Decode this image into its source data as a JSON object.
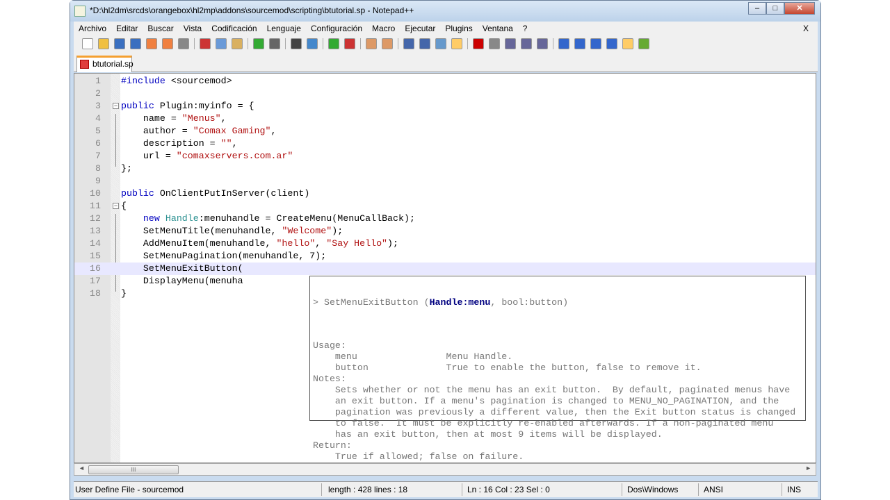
{
  "window": {
    "title": "*D:\\hl2dm\\srcds\\orangebox\\hl2mp\\addons\\sourcemod\\scripting\\btutorial.sp - Notepad++",
    "minimize": "–",
    "maximize": "□",
    "close": "✕"
  },
  "menu": {
    "items": [
      "Archivo",
      "Editar",
      "Buscar",
      "Vista",
      "Codificación",
      "Lenguaje",
      "Configuración",
      "Macro",
      "Ejecutar",
      "Plugins",
      "Ventana",
      "?"
    ],
    "close": "X"
  },
  "toolbar": {
    "icons": [
      "new-file",
      "open-file",
      "save",
      "save-all",
      "close",
      "close-all",
      "print",
      "cut",
      "copy",
      "paste",
      "undo",
      "redo",
      "find",
      "replace",
      "zoom-in",
      "zoom-out",
      "sync-vertical",
      "sync-horizontal",
      "word-wrap",
      "show-all-chars",
      "indent-guide",
      "user-lang",
      "record-macro",
      "stop-record",
      "play-macro",
      "run-macro-multiple",
      "save-macro",
      "fold-all",
      "up",
      "down",
      "unfold",
      "document-map",
      "spell-check"
    ]
  },
  "tab": {
    "label": "btutorial.sp"
  },
  "editor": {
    "current_line": 16,
    "lines": [
      [
        {
          "t": "#include",
          "c": "k"
        },
        {
          "t": " <sourcemod>",
          "c": "d"
        }
      ],
      [],
      [
        {
          "t": "public",
          "c": "k"
        },
        {
          "t": " Plugin:myinfo = {",
          "c": "d"
        }
      ],
      [
        {
          "t": "    name = ",
          "c": "d"
        },
        {
          "t": "\"Menus\"",
          "c": "s"
        },
        {
          "t": ",",
          "c": "d"
        }
      ],
      [
        {
          "t": "    author = ",
          "c": "d"
        },
        {
          "t": "\"Comax Gaming\"",
          "c": "s"
        },
        {
          "t": ",",
          "c": "d"
        }
      ],
      [
        {
          "t": "    description = ",
          "c": "d"
        },
        {
          "t": "\"\"",
          "c": "s"
        },
        {
          "t": ",",
          "c": "d"
        }
      ],
      [
        {
          "t": "    url = ",
          "c": "d"
        },
        {
          "t": "\"comaxservers.com.ar\"",
          "c": "s"
        }
      ],
      [
        {
          "t": "};",
          "c": "d"
        }
      ],
      [],
      [
        {
          "t": "public",
          "c": "k"
        },
        {
          "t": " OnClientPutInServer(client)",
          "c": "d"
        }
      ],
      [
        {
          "t": "{",
          "c": "d"
        }
      ],
      [
        {
          "t": "    ",
          "c": "d"
        },
        {
          "t": "new",
          "c": "k"
        },
        {
          "t": " ",
          "c": "d"
        },
        {
          "t": "Handle",
          "c": "t"
        },
        {
          "t": ":menuhandle = CreateMenu(MenuCallBack);",
          "c": "d"
        }
      ],
      [
        {
          "t": "    SetMenuTitle(menuhandle, ",
          "c": "d"
        },
        {
          "t": "\"Welcome\"",
          "c": "s"
        },
        {
          "t": ");",
          "c": "d"
        }
      ],
      [
        {
          "t": "    AddMenuItem(menuhandle, ",
          "c": "d"
        },
        {
          "t": "\"hello\"",
          "c": "s"
        },
        {
          "t": ", ",
          "c": "d"
        },
        {
          "t": "\"Say Hello\"",
          "c": "s"
        },
        {
          "t": ");",
          "c": "d"
        }
      ],
      [
        {
          "t": "    SetMenuPagination(menuhandle, 7);",
          "c": "d"
        }
      ],
      [
        {
          "t": "    SetMenuExitButton(",
          "c": "d"
        }
      ],
      [
        {
          "t": "    DisplayMenu(menuha",
          "c": "d"
        }
      ],
      [
        {
          "t": "}",
          "c": "d"
        }
      ]
    ]
  },
  "calltip": {
    "sig_pre": "> SetMenuExitButton (",
    "sig_hl": "Handle:menu",
    "sig_post": ", bool:button)",
    "lines": [
      "",
      "Usage:",
      "    menu                Menu Handle.",
      "    button              True to enable the button, false to remove it.",
      "Notes:",
      "    Sets whether or not the menu has an exit button.  By default, paginated menus have",
      "    an exit button. If a menu's pagination is changed to MENU_NO_PAGINATION, and the",
      "    pagination was previously a different value, then the Exit button status is changed",
      "    to false.  It must be explicitly re-enabled afterwards. If a non-paginated menu",
      "    has an exit button, then at most 9 items will be displayed.",
      "Return:",
      "    True if allowed; false on failure."
    ]
  },
  "scrollbar": {
    "grip": "III",
    "left": "◄",
    "right": "►"
  },
  "status": {
    "lang": "User Define File - sourcemod",
    "length": "length : 428    lines : 18",
    "pos": "Ln : 16    Col : 23    Sel : 0",
    "eol": "Dos\\Windows",
    "enc": "ANSI",
    "mode": "INS"
  }
}
